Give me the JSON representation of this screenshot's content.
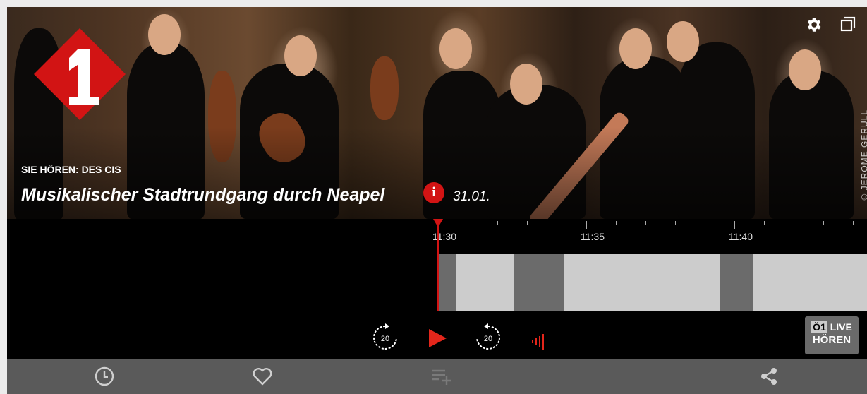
{
  "hero": {
    "kicker": "SIE HÖREN: DES CIS",
    "title": "Musikalischer Stadtrundgang durch Neapel",
    "info_icon": "info-icon",
    "info_glyph": "i",
    "date": "31.01.",
    "credit": "© JEROME GERULL"
  },
  "top_controls": {
    "settings_icon": "gear-icon",
    "popout_icon": "popout-window-icon"
  },
  "timeline": {
    "labels": [
      "11:30",
      "11:35",
      "11:40"
    ],
    "progress_fraction": 0.0,
    "colors": {
      "light": "#cccccc",
      "dark": "#6b6b6b",
      "playhead": "#d21414"
    }
  },
  "controls": {
    "rewind_label": "20",
    "forward_label": "20",
    "rewind_icon": "rewind-20-icon",
    "play_icon": "play-icon",
    "forward_icon": "forward-20-icon",
    "volume_icon": "volume-bars-icon",
    "live": {
      "o1": "Ö1",
      "live": "LIVE",
      "hoeren": "HÖREN"
    }
  },
  "toolbar": {
    "history_icon": "clock-icon",
    "favorite_icon": "heart-icon",
    "playlist_add_icon": "playlist-add-icon",
    "share_icon": "share-icon"
  }
}
